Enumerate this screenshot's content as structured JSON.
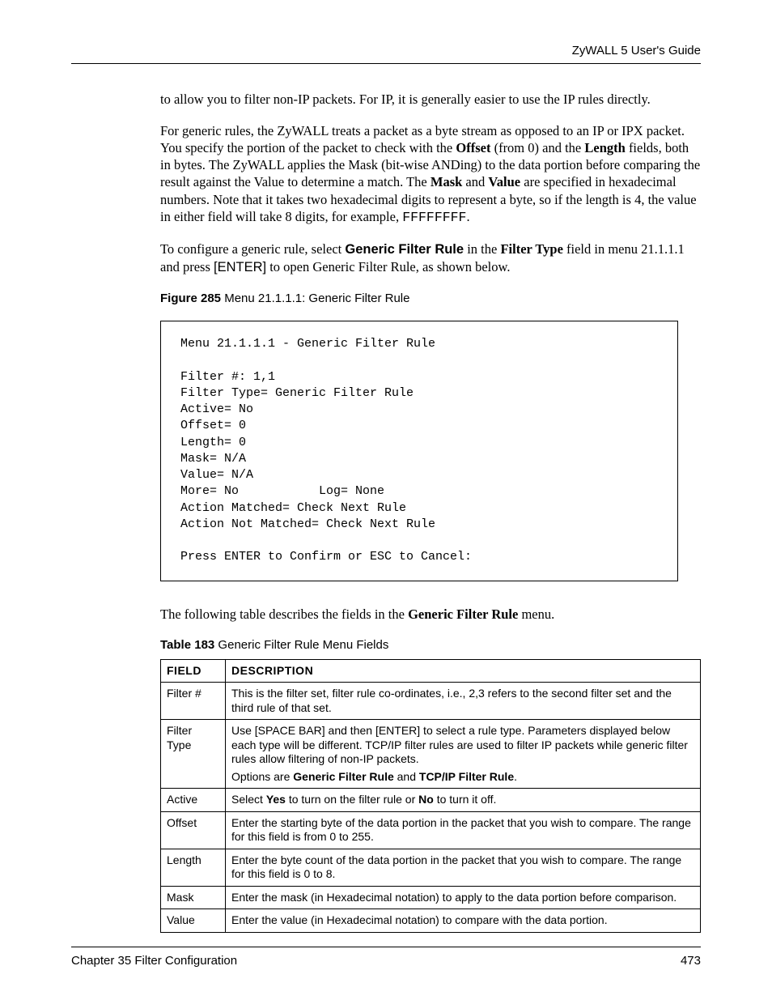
{
  "header": {
    "guide_title": "ZyWALL 5 User's Guide"
  },
  "body": {
    "p1": "to allow you to filter non-IP packets. For IP, it is generally easier to use the IP rules directly.",
    "p2_a": "For generic rules, the ZyWALL treats a packet as a byte stream as opposed to an IP or IPX packet. You specify the portion of the packet to check with the ",
    "p2_offset": "Offset",
    "p2_b": " (from 0) and the ",
    "p2_length": "Length",
    "p2_c": " fields, both in bytes. The ZyWALL applies the Mask (bit-wise ANDing) to the data portion before comparing the result against the Value to determine a match. The ",
    "p2_mask": "Mask",
    "p2_d": " and ",
    "p2_value": "Value",
    "p2_e": " are specified in hexadecimal numbers. Note that it takes two hexadecimal digits to represent a byte, so if the length is 4, the value in either field will take 8 digits, for example, ",
    "p2_code": "FFFFFFFF",
    "p2_f": ".",
    "p3_a": "To configure a generic rule, select ",
    "p3_b1": "Generic Filter Rule",
    "p3_b": " in the ",
    "p3_b2": "Filter Type",
    "p3_c": " field in menu 21.1.1.1 and press ",
    "p3_enter": "[ENTER]",
    "p3_d": " to open Generic Filter Rule, as shown below.",
    "fig_label": "Figure 285",
    "fig_title": "   Menu 21.1.1.1: Generic Filter Rule",
    "code": "Menu 21.1.1.1 - Generic Filter Rule\n\nFilter #: 1,1\nFilter Type= Generic Filter Rule\nActive= No\nOffset= 0\nLength= 0\nMask= N/A\nValue= N/A\nMore= No           Log= None\nAction Matched= Check Next Rule\nAction Not Matched= Check Next Rule\n\nPress ENTER to Confirm or ESC to Cancel:",
    "p4_a": "The following table describes the fields in the ",
    "p4_b": "Generic Filter Rule",
    "p4_c": " menu.",
    "tbl_label": "Table 183",
    "tbl_title": "   Generic Filter Rule Menu Fields",
    "table": {
      "head_field": "FIELD",
      "head_desc": "DESCRIPTION",
      "rows": [
        {
          "field": "Filter #",
          "desc": "This is the filter set, filter rule co-ordinates, i.e., 2,3 refers to the second filter set and the third rule of that set."
        },
        {
          "field": "Filter Type",
          "desc": "Use [SPACE BAR] and then [ENTER] to select a rule type. Parameters displayed below each type will be different. TCP/IP filter rules are used to filter IP packets while generic filter rules allow filtering of non-IP packets.",
          "desc2_a": "Options are ",
          "desc2_b1": "Generic Filter Rule",
          "desc2_b": " and ",
          "desc2_b2": "TCP/IP Filter Rule",
          "desc2_c": "."
        },
        {
          "field": "Active",
          "desc_a": "Select ",
          "desc_b1": "Yes",
          "desc_b": " to turn on the filter rule or ",
          "desc_b2": "No",
          "desc_c": " to turn it off."
        },
        {
          "field": "Offset",
          "desc": "Enter the starting byte of the data portion in the packet that you wish to compare. The range for this field is from 0 to 255."
        },
        {
          "field": "Length",
          "desc": "Enter the byte count of the data portion in the packet that you wish to compare. The range for this field is 0 to 8."
        },
        {
          "field": "Mask",
          "desc": "Enter the mask (in Hexadecimal notation) to apply to the data portion before comparison."
        },
        {
          "field": "Value",
          "desc": "Enter the value (in Hexadecimal notation) to compare with the data portion."
        }
      ]
    }
  },
  "footer": {
    "chapter": "Chapter 35 Filter Configuration",
    "page": "473"
  }
}
